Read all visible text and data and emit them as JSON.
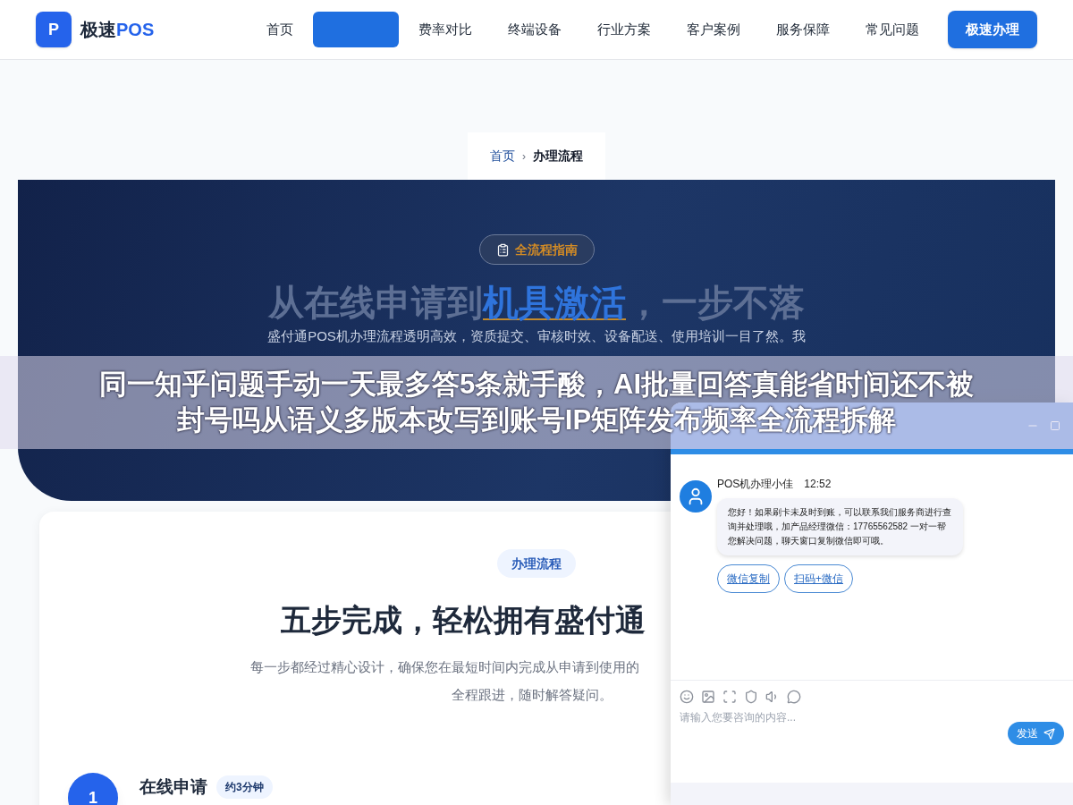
{
  "nav": {
    "logo_letter": "P",
    "brand": "极速",
    "brand_accent": "POS",
    "items": [
      {
        "label": "首页",
        "selected": false
      },
      {
        "selected": true
      },
      {
        "label": "费率对比",
        "selected": false
      },
      {
        "label": "终端设备",
        "selected": false
      },
      {
        "label": "行业方案",
        "selected": false
      },
      {
        "label": "客户案例",
        "selected": false
      },
      {
        "label": "服务保障",
        "selected": false
      },
      {
        "label": "常见问题",
        "selected": false
      }
    ],
    "cta": "极速办理"
  },
  "breadcrumb": {
    "separator": "›",
    "items": [
      {
        "label": "首页",
        "selected": false
      },
      {
        "label": "办理流程",
        "selected": true
      }
    ]
  },
  "hero": {
    "badge": "全流程指南",
    "title": {
      "before": "从在线申请到",
      "highlight": "机具激活",
      "after": "，一步不落"
    },
    "description": "盛付通POS机办理流程透明高效，资质提交、审核时效、设备配送、使用培训一目了然。我"
  },
  "banner": {
    "lines": [
      "同一知乎问题手动一天最多答5条就手酸，AI批量回答真能省时间还不被",
      "封号吗从语义多版本改写到账号IP矩阵发布频率全流程拆解"
    ]
  },
  "process": {
    "badge": "办理流程",
    "title": "五步完成，轻松拥有盛付通",
    "description_lines": [
      "每一步都经过精心设计，确保您在最短时间内完成从申请到使用的",
      "全程跟进，随时解答疑问。"
    ],
    "steps": [
      {
        "number": "1",
        "title": "在线申请",
        "duration": "约3分钟"
      }
    ]
  },
  "chat": {
    "agent": "POS机办理小佳",
    "time": "12:52",
    "message": "您好！如果刷卡未及时到账，可以联系我们服务商进行查询并处理哦，加产品经理微信：17765562582 一对一帮您解决问题，聊天窗口复制微信即可哦。",
    "actions": [
      "微信复制",
      "扫码+微信"
    ],
    "input": {
      "placeholder": "请输入您要咨询的内容..."
    },
    "send": "发送"
  }
}
